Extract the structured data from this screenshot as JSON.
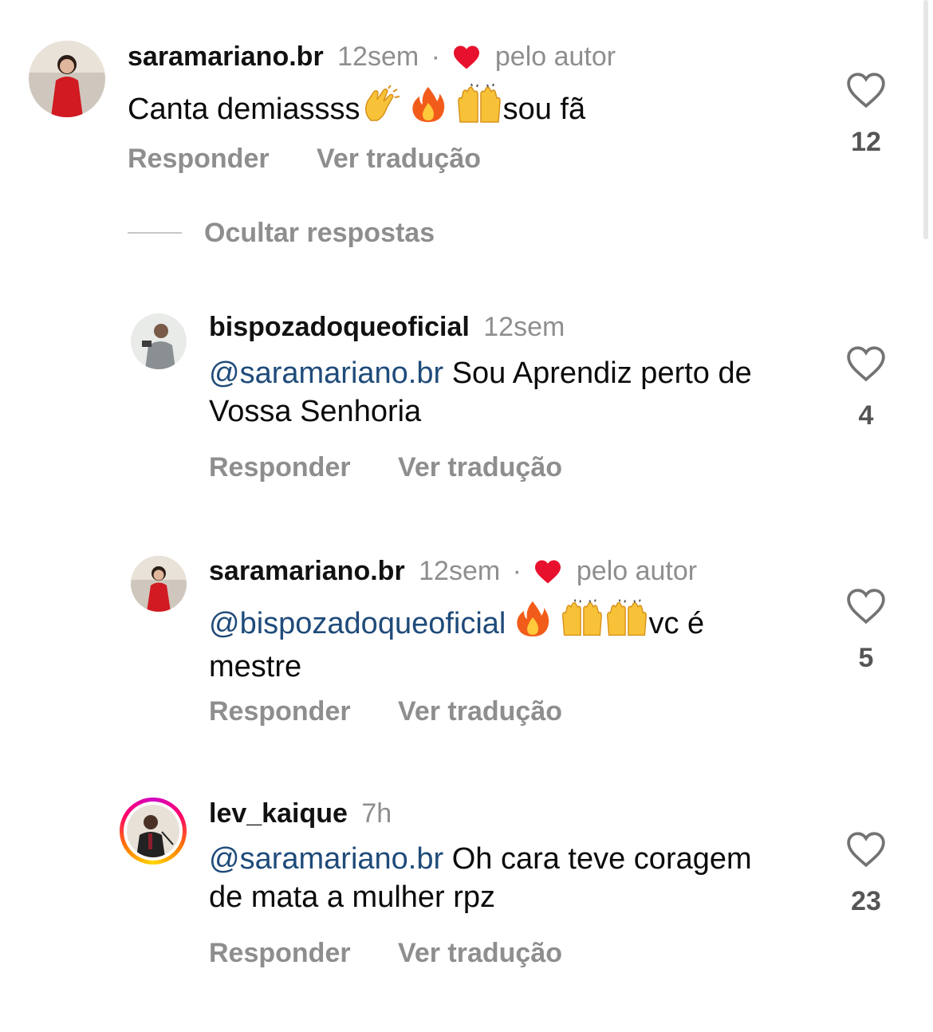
{
  "hide_replies_label": "Ocultar respostas",
  "comments": [
    {
      "username": "saramariano.br",
      "time": "12sem",
      "liked_by_author": "pelo autor",
      "text_before": "Canta demiassss",
      "text_after": "sou fã",
      "reply_label": "Responder",
      "translate_label": "Ver tradução",
      "likes": "12"
    },
    {
      "username": "bispozadoqueoficial",
      "time": "12sem",
      "mention": "@saramariano.br",
      "text": " Sou Aprendiz perto de Vossa Senhoria",
      "reply_label": "Responder",
      "translate_label": "Ver tradução",
      "likes": "4"
    },
    {
      "username": "saramariano.br",
      "time": "12sem",
      "liked_by_author": "pelo autor",
      "mention": "@bispozadoqueoficial",
      "text_after": "vc é mestre",
      "reply_label": "Responder",
      "translate_label": "Ver tradução",
      "likes": "5"
    },
    {
      "username": "lev_kaique",
      "time": "7h",
      "mention": "@saramariano.br",
      "text": " Oh cara teve coragem de mata a mulher rpz",
      "reply_label": "Responder",
      "translate_label": "Ver tradução",
      "likes": "23"
    }
  ],
  "icons": {
    "like": "heart-outline-icon",
    "author_like": "red-heart-icon",
    "emoji_clap": "clapping-hands-emoji",
    "emoji_fire": "fire-emoji",
    "emoji_raise": "raising-hands-emoji"
  },
  "colors": {
    "mention": "#1f4b7a",
    "secondary": "#8e8e8e",
    "heart": "#e8112d"
  }
}
